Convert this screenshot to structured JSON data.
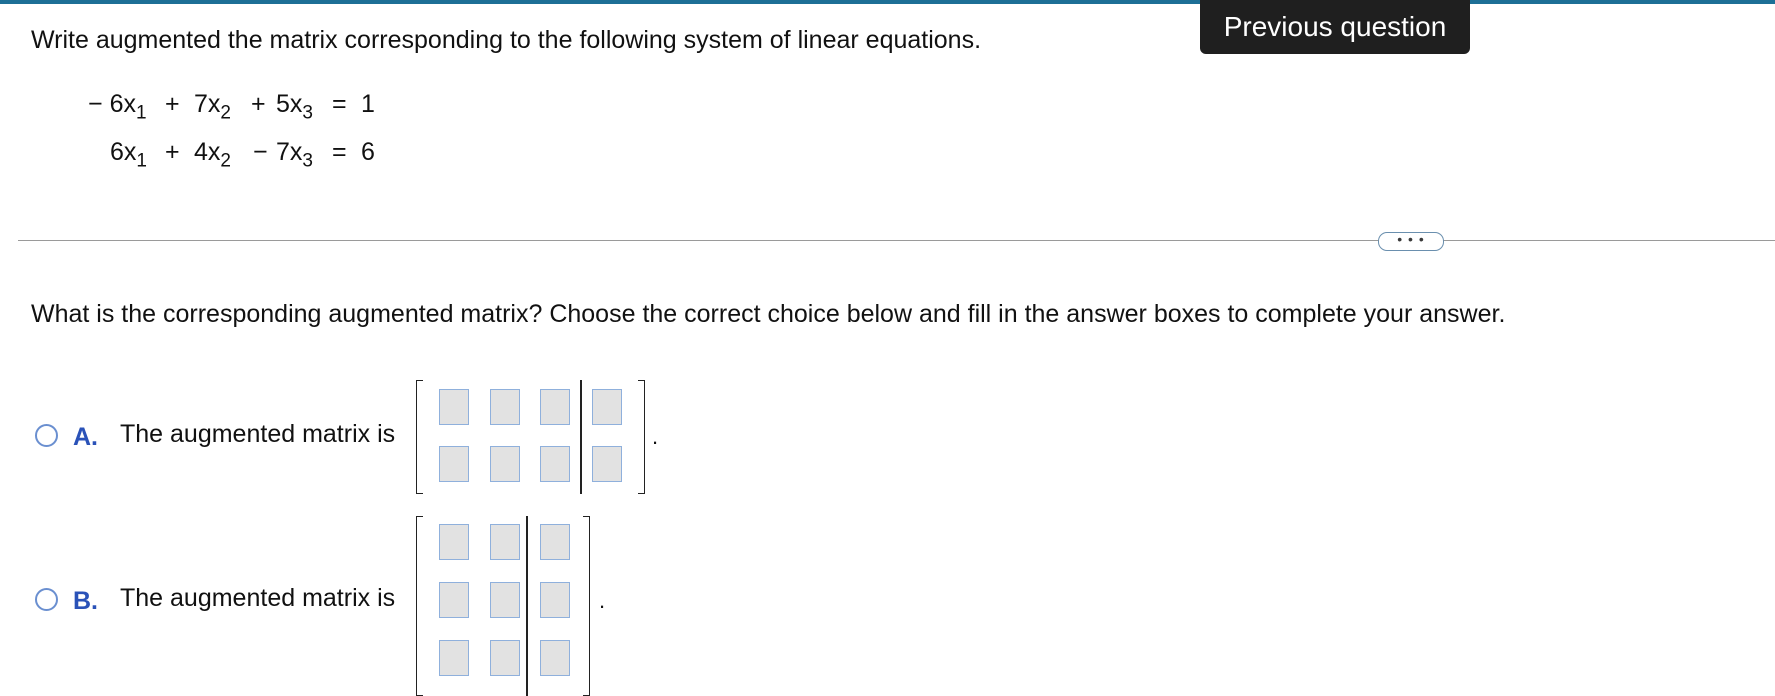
{
  "header": {
    "previous_question_label": "Previous question"
  },
  "problem": {
    "instruction": "Write augmented the matrix corresponding to the following system of linear equations.",
    "equations": [
      {
        "t1": {
          "sign": "−",
          "coef": "6x",
          "sub": "1"
        },
        "op2": "+",
        "t2": {
          "coef": "7x",
          "sub": "2"
        },
        "op3": "+",
        "t3": {
          "coef": "5x",
          "sub": "3"
        },
        "eq": "=",
        "rhs": "1"
      },
      {
        "t1": {
          "sign": "",
          "coef": "6x",
          "sub": "1"
        },
        "op2": "+",
        "t2": {
          "coef": "4x",
          "sub": "2"
        },
        "op3": "−",
        "t3": {
          "coef": "7x",
          "sub": "3"
        },
        "eq": "=",
        "rhs": "6"
      }
    ]
  },
  "divider": {
    "more_label": "• • •"
  },
  "question": {
    "text": "What is the corresponding augmented matrix? Choose the correct choice below and fill in the answer boxes to complete your answer."
  },
  "choices": [
    {
      "letter": "A.",
      "text": "The augmented matrix is",
      "rows": 2,
      "cols": 4,
      "period": "."
    },
    {
      "letter": "B.",
      "text": "The augmented matrix is",
      "rows": 3,
      "cols": 3,
      "period": "."
    }
  ],
  "colors": {
    "top_bar": "#1d6f96",
    "choice_letter": "#2a52b8",
    "radio_border": "#6a8fd0",
    "cell_fill": "#e2e2e2",
    "cell_border": "#8fb0dc"
  }
}
